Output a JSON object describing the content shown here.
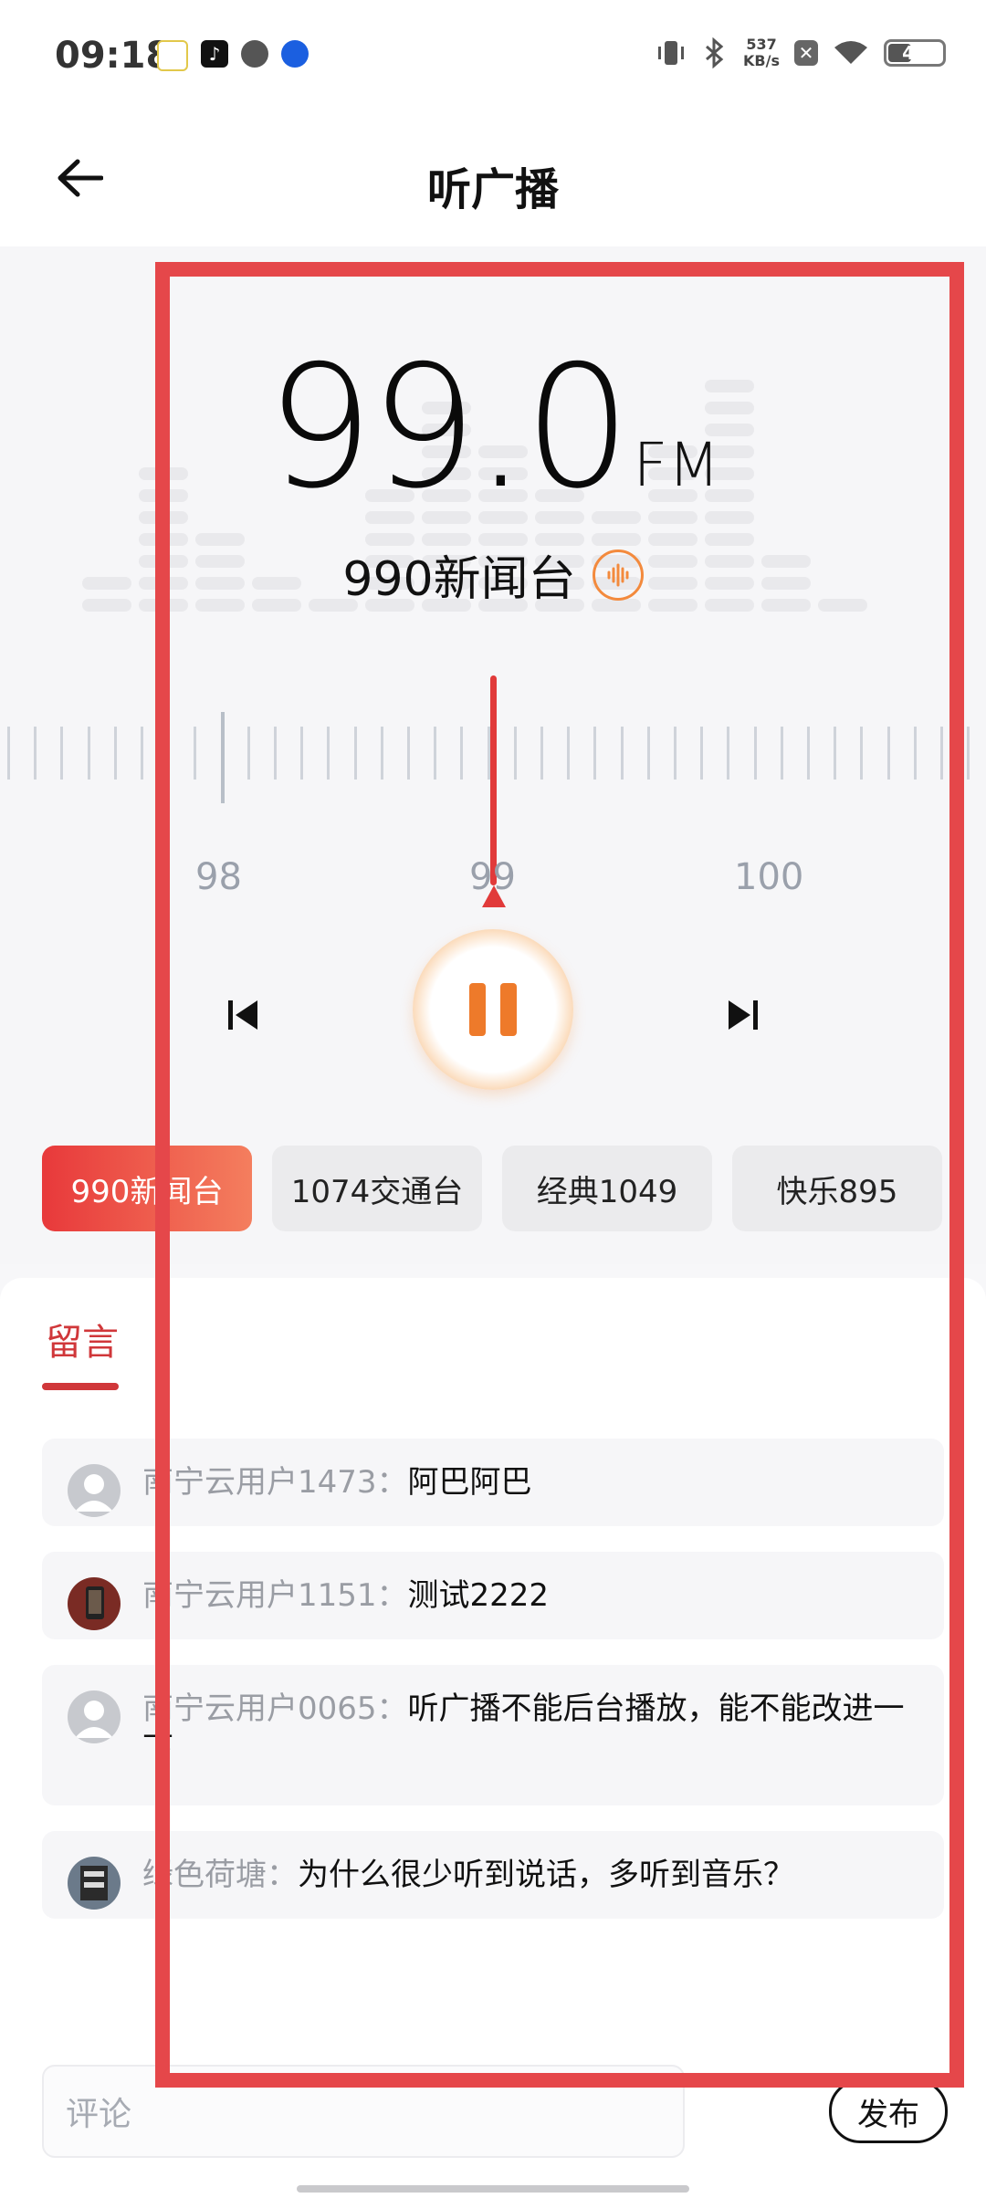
{
  "status_bar": {
    "time": "09:18",
    "network_speed_value": "537",
    "network_speed_unit": "KB/s",
    "battery": "41"
  },
  "header": {
    "title": "听广播"
  },
  "player": {
    "frequency": "99.0",
    "unit": "FM",
    "station": "990新闻台",
    "scale_labels": [
      "98",
      "99",
      "100"
    ]
  },
  "stations": [
    {
      "label": "990新闻台",
      "active": true
    },
    {
      "label": "1074交通台",
      "active": false
    },
    {
      "label": "经典1049",
      "active": false
    },
    {
      "label": "快乐895",
      "active": false
    }
  ],
  "comments": {
    "tab_label": "留言",
    "items": [
      {
        "user": "南宁云用户1473：",
        "text": "阿巴阿巴"
      },
      {
        "user": "南宁云用户1151：",
        "text": "测试2222"
      },
      {
        "user": "南宁云用户0065：",
        "text": "听广播不能后台播放，能不能改进一下"
      },
      {
        "user": "绿色荷塘：",
        "text": "为什么很少听到说话，多听到音乐？"
      }
    ],
    "input_placeholder": "评论",
    "publish_label": "发布"
  }
}
